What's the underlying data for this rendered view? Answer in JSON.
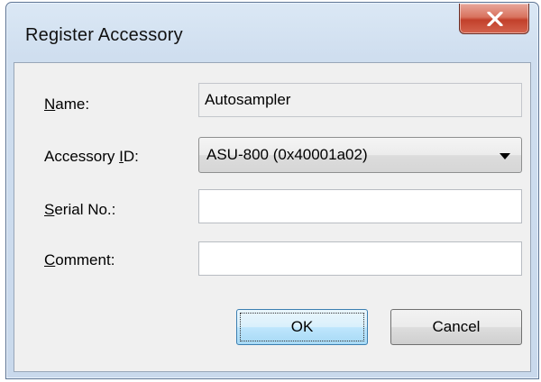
{
  "window": {
    "title": "Register Accessory"
  },
  "form": {
    "name": {
      "label_mnemonic": "N",
      "label_rest": "ame:",
      "value": "Autosampler"
    },
    "accessory_id": {
      "label_before": "Accessory ",
      "label_mnemonic": "I",
      "label_after": "D:",
      "selected": "ASU-800 (0x40001a02)"
    },
    "serial_no": {
      "label_mnemonic": "S",
      "label_rest": "erial No.:",
      "value": ""
    },
    "comment": {
      "label_mnemonic": "C",
      "label_rest": "omment:",
      "value": ""
    }
  },
  "buttons": {
    "ok_label": "OK",
    "cancel_label": "Cancel"
  },
  "icons": {
    "close": "close-icon",
    "dropdown": "chevron-down-icon"
  },
  "colors": {
    "close_button": "#c7432e",
    "default_button_border": "#3c7fb1",
    "window_frame": "#cfdeef"
  }
}
